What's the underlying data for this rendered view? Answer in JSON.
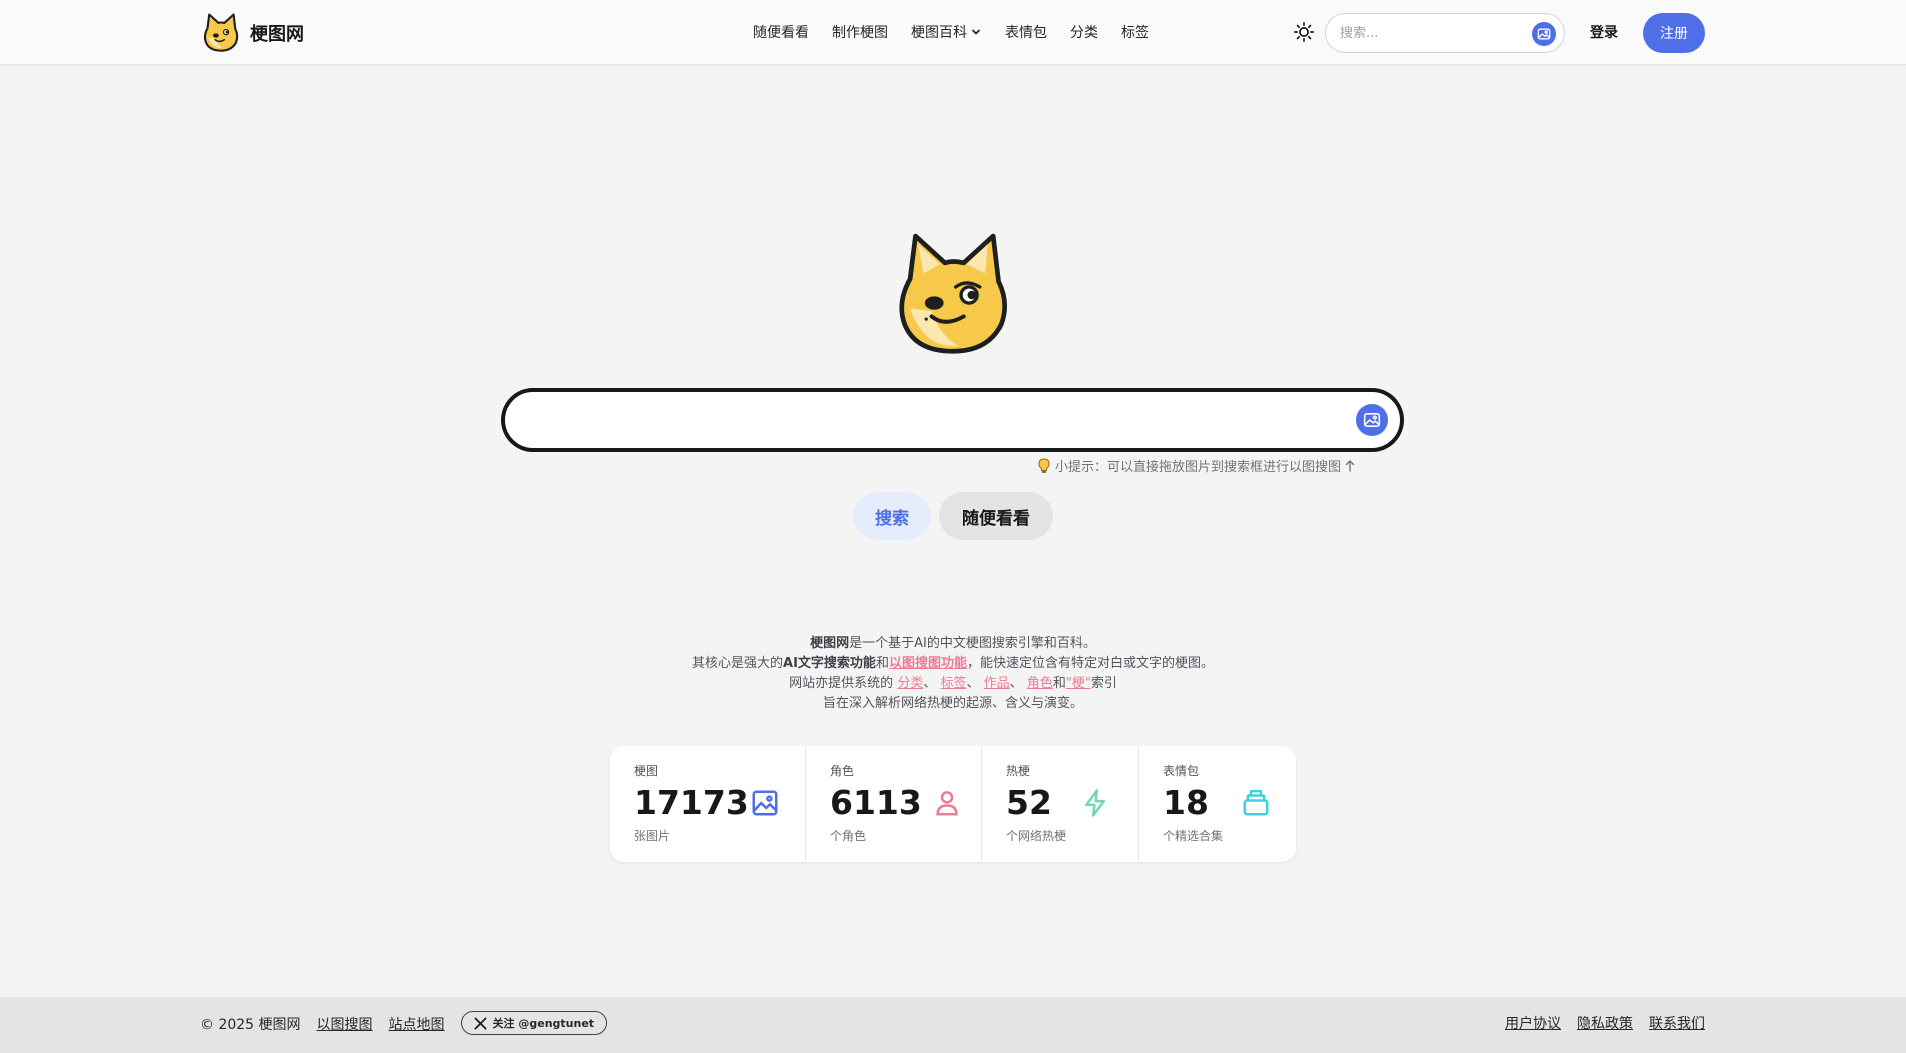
{
  "header": {
    "logo_text": "梗图网",
    "nav": [
      {
        "label": "随便看看"
      },
      {
        "label": "制作梗图"
      },
      {
        "label": "梗图百科"
      },
      {
        "label": "表情包"
      },
      {
        "label": "分类"
      },
      {
        "label": "标签"
      }
    ],
    "search_placeholder": "搜索...",
    "login_label": "登录",
    "signup_label": "注册"
  },
  "hero": {
    "search_value": "",
    "tip": "小提示：可以直接拖放图片到搜索框进行以图搜图",
    "search_button": "搜索",
    "random_button": "随便看看"
  },
  "description": {
    "line1_bold": "梗图网",
    "line1_rest": "是一个基于AI的中文梗图搜索引擎和百科。",
    "line2_pre": "其核心是强大的",
    "line2_bold": "AI文字搜索功能",
    "line2_and": "和",
    "line2_link": "以图搜图功能",
    "line2_post": "，能快速定位含有特定对白或文字的梗图。",
    "line3_pre": "网站亦提供系统的",
    "link_category": "分类",
    "sep1": "、",
    "link_tag": "标签",
    "sep2": "、",
    "link_work": "作品",
    "sep3": "、",
    "link_character": "角色",
    "and2": "和",
    "link_meme": "\"梗\"",
    "line3_post": "索引",
    "line4": "旨在深入解析网络热梗的起源、含义与演变。"
  },
  "stats": [
    {
      "title": "梗图",
      "value": "17173",
      "desc": "张图片",
      "icon": "image-icon",
      "color": "#4f6fe8"
    },
    {
      "title": "角色",
      "value": "6113",
      "desc": "个角色",
      "icon": "user-icon",
      "color": "#ec7c93"
    },
    {
      "title": "热梗",
      "value": "52",
      "desc": "个网络热梗",
      "icon": "bolt-icon",
      "color": "#6fd9b5"
    },
    {
      "title": "表情包",
      "value": "18",
      "desc": "个精选合集",
      "icon": "stack-icon",
      "color": "#3fd0e0"
    }
  ],
  "footer": {
    "copyright": "© 2025 梗图网",
    "links_left": [
      "以图搜图",
      "站点地图"
    ],
    "x_badge": "关注 @gengtunet",
    "links_right": [
      "用户协议",
      "隐私政策",
      "联系我们"
    ]
  },
  "colors": {
    "accent": "#4f6fe8",
    "pink_link": "#ec7c93",
    "doge": "#f6c94a"
  }
}
